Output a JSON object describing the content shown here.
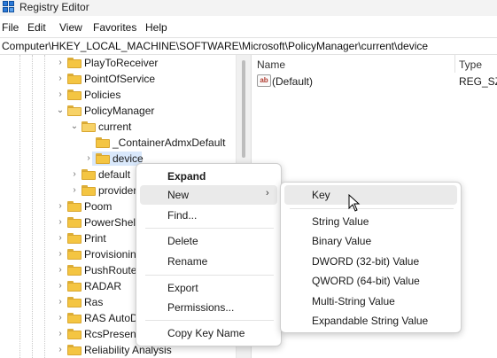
{
  "window": {
    "title": "Registry Editor"
  },
  "menu": [
    "File",
    "Edit",
    "View",
    "Favorites",
    "Help"
  ],
  "address": "Computer\\HKEY_LOCAL_MACHINE\\SOFTWARE\\Microsoft\\PolicyManager\\current\\device",
  "tree": {
    "items": [
      {
        "label": "PlayToReceiver",
        "state": "collapsed"
      },
      {
        "label": "PointOfService",
        "state": "collapsed"
      },
      {
        "label": "Policies",
        "state": "collapsed"
      },
      {
        "label": "PolicyManager",
        "state": "expanded"
      },
      {
        "label": "current",
        "state": "expanded"
      },
      {
        "label": "_ContainerAdmxDefault",
        "state": "none"
      },
      {
        "label": "device",
        "state": "collapsed",
        "selected": true
      },
      {
        "label": "default",
        "state": "collapsed"
      },
      {
        "label": "provider",
        "state": "collapsed"
      },
      {
        "label": "Poom",
        "state": "collapsed"
      },
      {
        "label": "PowerShell",
        "state": "collapsed"
      },
      {
        "label": "Print",
        "state": "collapsed"
      },
      {
        "label": "Provisionin",
        "state": "collapsed"
      },
      {
        "label": "PushRouter",
        "state": "collapsed"
      },
      {
        "label": "RADAR",
        "state": "collapsed"
      },
      {
        "label": "Ras",
        "state": "collapsed"
      },
      {
        "label": "RAS AutoD",
        "state": "collapsed"
      },
      {
        "label": "RcsPresence",
        "state": "collapsed"
      },
      {
        "label": "Reliability Analysis",
        "state": "collapsed"
      }
    ]
  },
  "values_pane": {
    "columns": {
      "name": "Name",
      "type": "Type"
    },
    "rows": [
      {
        "name": "(Default)",
        "type": "REG_SZ",
        "icon": "string-value-icon"
      }
    ]
  },
  "context_menu": {
    "items": [
      "Expand",
      "New",
      "Find...",
      "Delete",
      "Rename",
      "Export",
      "Permissions...",
      "Copy Key Name"
    ]
  },
  "submenu": {
    "items": [
      "Key",
      "String Value",
      "Binary Value",
      "DWORD (32-bit) Value",
      "QWORD (64-bit) Value",
      "Multi-String Value",
      "Expandable String Value"
    ]
  },
  "colors": {
    "selection": "#d9e8fb",
    "folder": "#f4c542",
    "hover": "#eaeaea"
  }
}
